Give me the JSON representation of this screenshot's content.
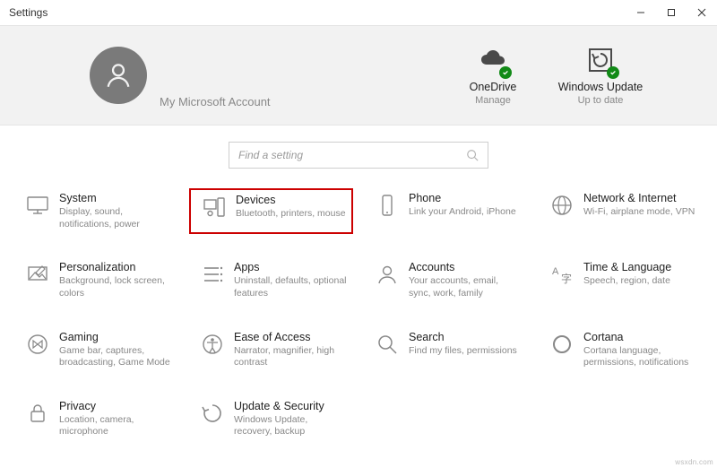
{
  "window": {
    "title": "Settings"
  },
  "header": {
    "account_label": "My Microsoft Account",
    "quick": [
      {
        "title": "OneDrive",
        "sub": "Manage"
      },
      {
        "title": "Windows Update",
        "sub": "Up to date"
      }
    ]
  },
  "search": {
    "placeholder": "Find a setting"
  },
  "tiles": [
    {
      "title": "System",
      "desc": "Display, sound, notifications, power"
    },
    {
      "title": "Devices",
      "desc": "Bluetooth, printers, mouse",
      "highlight": true
    },
    {
      "title": "Phone",
      "desc": "Link your Android, iPhone"
    },
    {
      "title": "Network & Internet",
      "desc": "Wi-Fi, airplane mode, VPN"
    },
    {
      "title": "Personalization",
      "desc": "Background, lock screen, colors"
    },
    {
      "title": "Apps",
      "desc": "Uninstall, defaults, optional features"
    },
    {
      "title": "Accounts",
      "desc": "Your accounts, email, sync, work, family"
    },
    {
      "title": "Time & Language",
      "desc": "Speech, region, date"
    },
    {
      "title": "Gaming",
      "desc": "Game bar, captures, broadcasting, Game Mode"
    },
    {
      "title": "Ease of Access",
      "desc": "Narrator, magnifier, high contrast"
    },
    {
      "title": "Search",
      "desc": "Find my files, permissions"
    },
    {
      "title": "Cortana",
      "desc": "Cortana language, permissions, notifications"
    },
    {
      "title": "Privacy",
      "desc": "Location, camera, microphone"
    },
    {
      "title": "Update & Security",
      "desc": "Windows Update, recovery, backup"
    }
  ],
  "watermark": "wsxdn.com"
}
